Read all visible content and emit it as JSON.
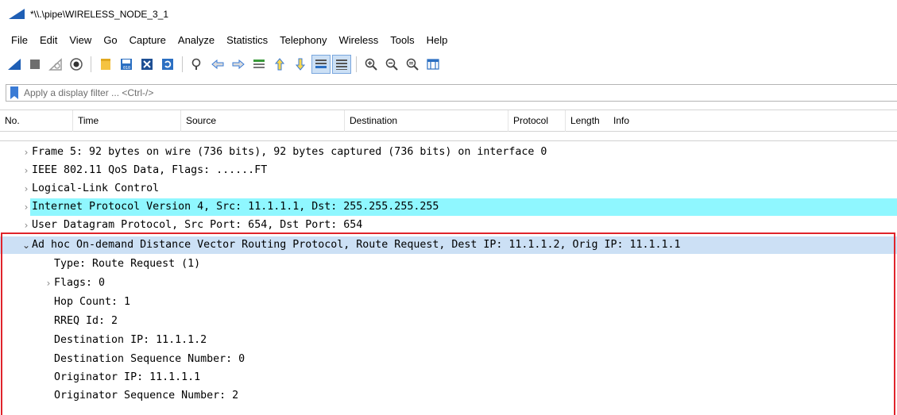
{
  "window": {
    "title": "*\\\\.\\pipe\\WIRELESS_NODE_3_1",
    "logo_icon": "wireshark-fin-icon",
    "accent": "#1f5fb5"
  },
  "menu": [
    "File",
    "Edit",
    "View",
    "Go",
    "Capture",
    "Analyze",
    "Statistics",
    "Telephony",
    "Wireless",
    "Tools",
    "Help"
  ],
  "toolbar": {
    "buttons": [
      "start-capture-icon",
      "stop-capture-icon",
      "restart-capture-icon",
      "capture-options-icon",
      "open-file-icon",
      "save-file-icon",
      "close-file-icon",
      "reload-file-icon",
      "find-packet-icon",
      "go-back-icon",
      "go-forward-icon",
      "go-to-packet-icon",
      "first-packet-icon",
      "last-packet-icon",
      "auto-scroll-icon",
      "colorize-icon",
      "zoom-in-icon",
      "zoom-out-icon",
      "normal-size-icon",
      "resize-columns-icon"
    ]
  },
  "filter": {
    "placeholder": "Apply a display filter ... <Ctrl-/>"
  },
  "columns": {
    "no": "No.",
    "time": "Time",
    "source": "Source",
    "destination": "Destination",
    "protocol": "Protocol",
    "length": "Length",
    "info": "Info"
  },
  "details": {
    "frame": "Frame 5: 92 bytes on wire (736 bits), 92 bytes captured (736 bits) on interface 0",
    "ieee": "IEEE 802.11 QoS Data, Flags: ......FT",
    "llc": "Logical-Link Control",
    "ipv4": "Internet Protocol Version 4, Src: 11.1.1.1, Dst: 255.255.255.255",
    "udp": "User Datagram Protocol, Src Port: 654, Dst Port: 654",
    "aodv": "Ad hoc On-demand Distance Vector Routing Protocol, Route Request, Dest IP: 11.1.1.2, Orig IP: 11.1.1.1",
    "aodv_fields": {
      "type": "Type: Route Request (1)",
      "flags": "Flags: 0",
      "hop_count": "Hop Count: 1",
      "rreq_id": "RREQ Id: 2",
      "dest_ip": "Destination IP: 11.1.1.2",
      "dest_seq": "Destination Sequence Number: 0",
      "orig_ip": "Originator IP: 11.1.1.1",
      "orig_seq": "Originator Sequence Number: 2"
    }
  },
  "colors": {
    "ipv4_highlight": "#8ff7ff",
    "selected_highlight": "#cce0f5",
    "annotation_border": "#e0242b"
  }
}
